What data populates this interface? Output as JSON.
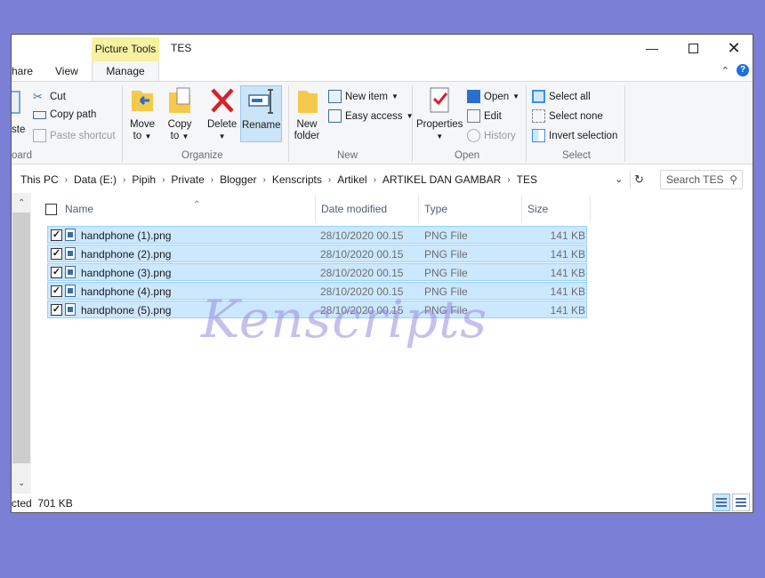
{
  "window": {
    "context_tab": "Picture Tools",
    "title": "TES"
  },
  "ribbon_tabs": {
    "share": "hare",
    "view": "View",
    "manage": "Manage"
  },
  "clipboard": {
    "paste_partial": "ste",
    "group_partial": "oard",
    "cut": "Cut",
    "copy_path": "Copy path",
    "paste_shortcut": "Paste shortcut"
  },
  "organize": {
    "move_to_1": "Move",
    "move_to_2": "to",
    "copy_to_1": "Copy",
    "copy_to_2": "to",
    "delete": "Delete",
    "rename": "Rename",
    "label": "Organize"
  },
  "new_group": {
    "new_folder_1": "New",
    "new_folder_2": "folder",
    "new_item": "New item",
    "easy_access": "Easy access",
    "label": "New"
  },
  "open_group": {
    "properties": "Properties",
    "open": "Open",
    "edit": "Edit",
    "history": "History",
    "label": "Open"
  },
  "select_group": {
    "select_all": "Select all",
    "select_none": "Select none",
    "invert_selection": "Invert selection",
    "label": "Select"
  },
  "breadcrumb": [
    "This PC",
    "Data (E:)",
    "Pipih",
    "Private",
    "Blogger",
    "Kenscripts",
    "Artikel",
    "ARTIKEL DAN GAMBAR",
    "TES"
  ],
  "search": {
    "placeholder": "Search TES"
  },
  "columns": {
    "name": "Name",
    "date": "Date modified",
    "type": "Type",
    "size": "Size"
  },
  "files": [
    {
      "name": "handphone (1).png",
      "date": "28/10/2020 00.15",
      "type": "PNG File",
      "size": "141 KB",
      "checked": true
    },
    {
      "name": "handphone (2).png",
      "date": "28/10/2020 00.15",
      "type": "PNG File",
      "size": "141 KB",
      "checked": true
    },
    {
      "name": "handphone (3).png",
      "date": "28/10/2020 00.15",
      "type": "PNG File",
      "size": "141 KB",
      "checked": true
    },
    {
      "name": "handphone (4).png",
      "date": "28/10/2020 00.15",
      "type": "PNG File",
      "size": "141 KB",
      "checked": true
    },
    {
      "name": "handphone (5).png",
      "date": "28/10/2020 00.15",
      "type": "PNG File",
      "size": "141 KB",
      "checked": true
    }
  ],
  "watermark": "Kenscripts",
  "status": {
    "text": "cted  701 KB"
  },
  "colors": {
    "selection": "#cce8ff",
    "context_tab": "#f6f2a2",
    "background": "#7b7fd6"
  }
}
